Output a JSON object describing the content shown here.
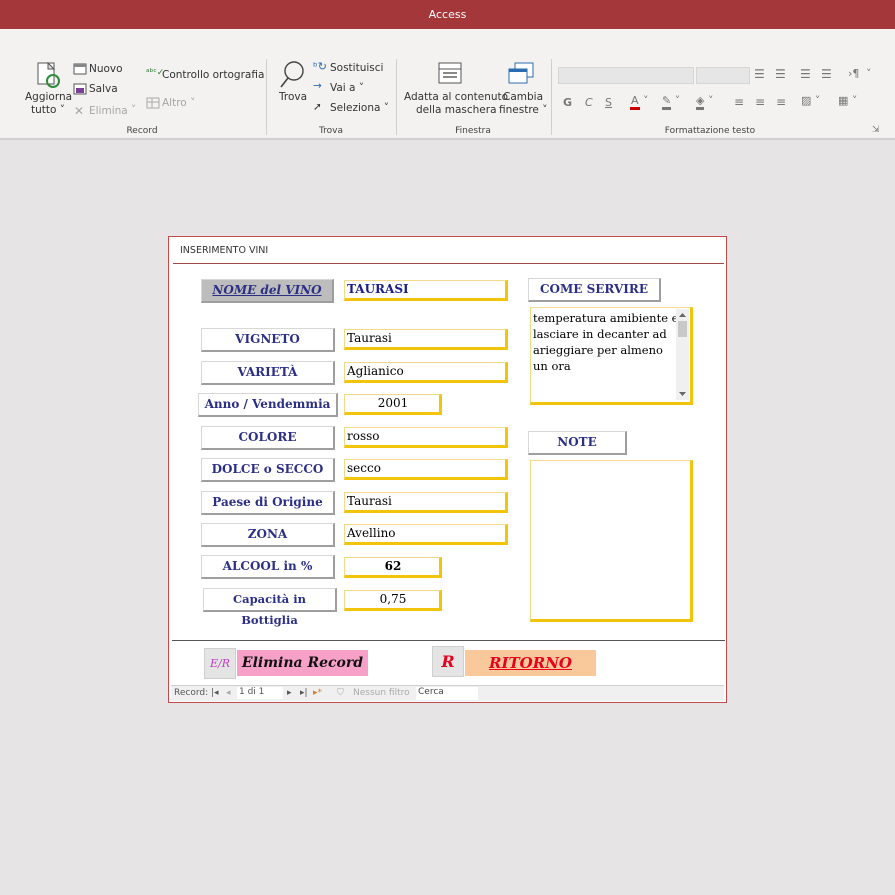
{
  "window": {
    "title": "Access"
  },
  "ribbon": {
    "record": {
      "refresh_line1": "Aggiorna",
      "refresh_line2": "tutto",
      "new": "Nuovo",
      "save": "Salva",
      "delete": "Elimina",
      "spelling": "Controllo ortografia",
      "more": "Altro",
      "group": "Record"
    },
    "find": {
      "find": "Trova",
      "replace": "Sostituisci",
      "goto": "Vai a",
      "select": "Seleziona",
      "group": "Trova"
    },
    "window": {
      "fit_line1": "Adatta al contenuto",
      "fit_line2": "della maschera",
      "switch_line1": "Cambia",
      "switch_line2": "finestre",
      "group": "Finestra"
    },
    "text_formatting": {
      "bold": "G",
      "italic": "C",
      "underline": "S",
      "group": "Formattazione testo"
    }
  },
  "form": {
    "title": "INSERIMENTO VINI",
    "labels": {
      "nome": "NOME del VINO",
      "vigneto": "VIGNETO",
      "varieta": "VARIETÀ",
      "anno": "Anno / Vendemmia",
      "colore": "COLORE",
      "dolce": "DOLCE o SECCO",
      "paese": "Paese di Origine",
      "zona": "ZONA",
      "alcool": "ALCOOL in %",
      "capacita": "Capacità in Bottiglia",
      "servire": "COME SERVIRE",
      "note": "NOTE"
    },
    "values": {
      "nome": "TAURASI",
      "vigneto": "Taurasi",
      "varieta": "Aglianico",
      "anno": "2001",
      "colore": "rosso",
      "dolce": "secco",
      "paese": "Taurasi",
      "zona": "Avellino",
      "alcool": "62",
      "capacita": "0,75",
      "servire": "temperatura amibiente e lasciare in decanter ad arieggiare per almeno un ora",
      "note": ""
    },
    "buttons": {
      "delete_icon": "E/R",
      "delete_label": "Elimina Record",
      "return_icon": "R",
      "return_label": "RITORNO"
    },
    "colors": {
      "label_text": "#2c2f86",
      "field_border": "#f2c40c",
      "delete_bg": "#f7a1c8",
      "return_bg": "#f9c89b",
      "return_text": "#e8001c"
    }
  },
  "navigation": {
    "record_label": "Record:",
    "position": "1 di 1",
    "filter": "Nessun filtro",
    "search": "Cerca"
  }
}
